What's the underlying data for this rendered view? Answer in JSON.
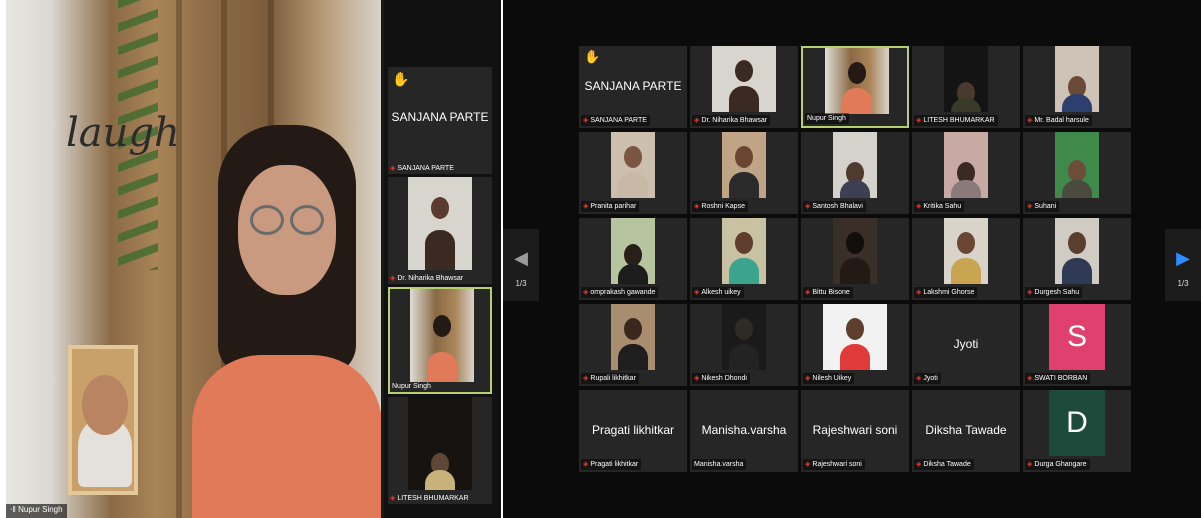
{
  "speaker_view": {
    "speaker_name": "Nupur Singh",
    "wall_text": "laugh",
    "strip_tiles": [
      {
        "name": "SANJANA PARTE",
        "display_name": "SANJANA PARTE",
        "video": false,
        "raised_hand": true
      },
      {
        "name": "Dr. Niharika Bhawsar",
        "video": true
      },
      {
        "name": "Nupur Singh",
        "video": true,
        "active_speaker": true
      },
      {
        "name": "LITESH BHUMARKAR",
        "video": true
      }
    ]
  },
  "gallery_view": {
    "prev_page_label": "1/3",
    "next_page_label": "1/3",
    "prev_icon": "chevron-left-icon",
    "next_icon": "chevron-right-icon",
    "accent_color": "#2d8cff",
    "active_border_color": "#b7cf6e",
    "participants": [
      {
        "name": "SANJANA PARTE",
        "display_name": "SANJANA PARTE",
        "raised_hand": true
      },
      {
        "name": "Dr. Niharika Bhawsar",
        "video": true
      },
      {
        "name": "Nupur Singh",
        "video": true,
        "active_speaker": true
      },
      {
        "name": "LITESH BHUMARKAR",
        "video": true
      },
      {
        "name": "Mr. Badal harsule",
        "video": true
      },
      {
        "name": "Pranita parihar",
        "video": true
      },
      {
        "name": "Roshni Kapse",
        "video": true
      },
      {
        "name": "Santosh Bhalavi",
        "video": true
      },
      {
        "name": "Kritika Sahu",
        "video": true
      },
      {
        "name": "Suhani",
        "video": true
      },
      {
        "name": "omprakash gawande",
        "video": true
      },
      {
        "name": "Alkesh uikey",
        "video": true
      },
      {
        "name": "Bittu Bisone",
        "video": true
      },
      {
        "name": "Lakshmi Ghorse",
        "video": true
      },
      {
        "name": "Durgesh Sahu",
        "video": true
      },
      {
        "name": "Rupali likhitkar",
        "video": true
      },
      {
        "name": "Nikesh Dhondi",
        "video": true
      },
      {
        "name": "Nilesh Uikey",
        "video": true
      },
      {
        "name": "Jyoti",
        "display_name": "Jyoti"
      },
      {
        "name": "SWATI BORBAN",
        "avatar_letter": "S",
        "avatar_color": "#e0406e"
      },
      {
        "name": "Pragati likhitkar",
        "display_name": "Pragati likhitkar"
      },
      {
        "name": "Manisha.varsha",
        "display_name": "Manisha.varsha"
      },
      {
        "name": "Rajeshwari soni",
        "display_name": "Rajeshwari soni"
      },
      {
        "name": "Diksha Tawade",
        "display_name": "Diksha Tawade"
      },
      {
        "name": "Durga Ghangare",
        "avatar_letter": "D",
        "avatar_color": "#1d4a3a"
      }
    ]
  }
}
